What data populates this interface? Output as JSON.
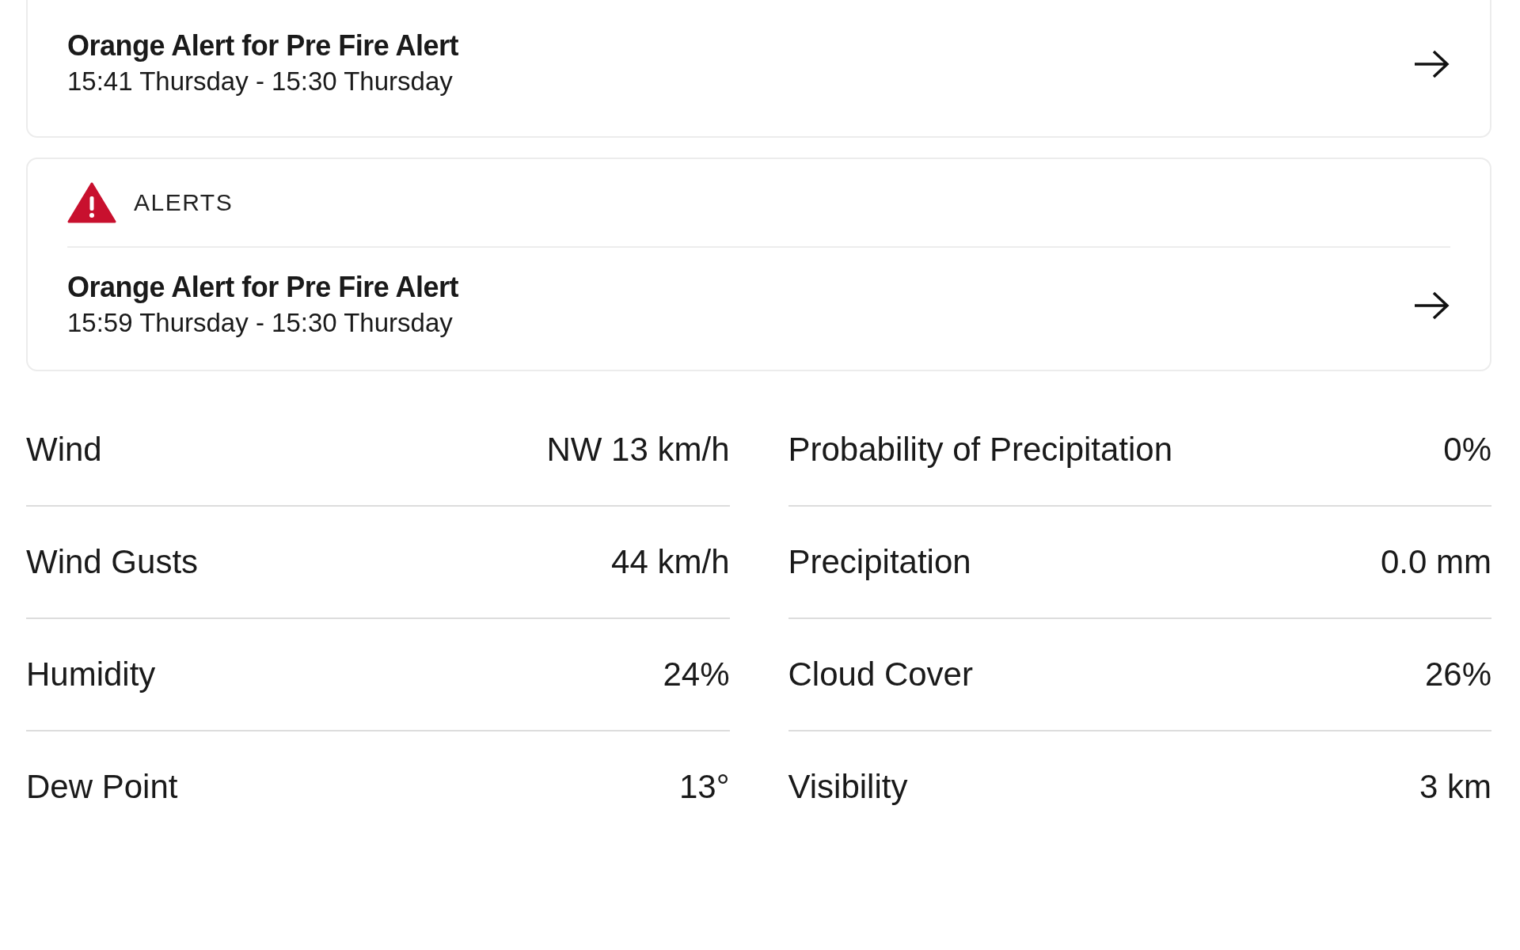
{
  "alert_cards": [
    {
      "alerts": [
        {
          "title": "Orange Alert for Pre Fire Alert",
          "time": "15:41 Thursday - 15:30 Thursday"
        }
      ]
    },
    {
      "header": "ALERTS",
      "alerts": [
        {
          "title": "Orange Alert for Pre Fire Alert",
          "time": "15:59 Thursday - 15:30 Thursday"
        }
      ]
    }
  ],
  "stats": {
    "left": [
      {
        "label": "Wind",
        "value": "NW 13 km/h"
      },
      {
        "label": "Wind Gusts",
        "value": "44 km/h"
      },
      {
        "label": "Humidity",
        "value": "24%"
      },
      {
        "label": "Dew Point",
        "value": "13°"
      }
    ],
    "right": [
      {
        "label": "Probability of Precipitation",
        "value": "0%"
      },
      {
        "label": "Precipitation",
        "value": "0.0 mm"
      },
      {
        "label": "Cloud Cover",
        "value": "26%"
      },
      {
        "label": "Visibility",
        "value": "3 km"
      }
    ]
  }
}
